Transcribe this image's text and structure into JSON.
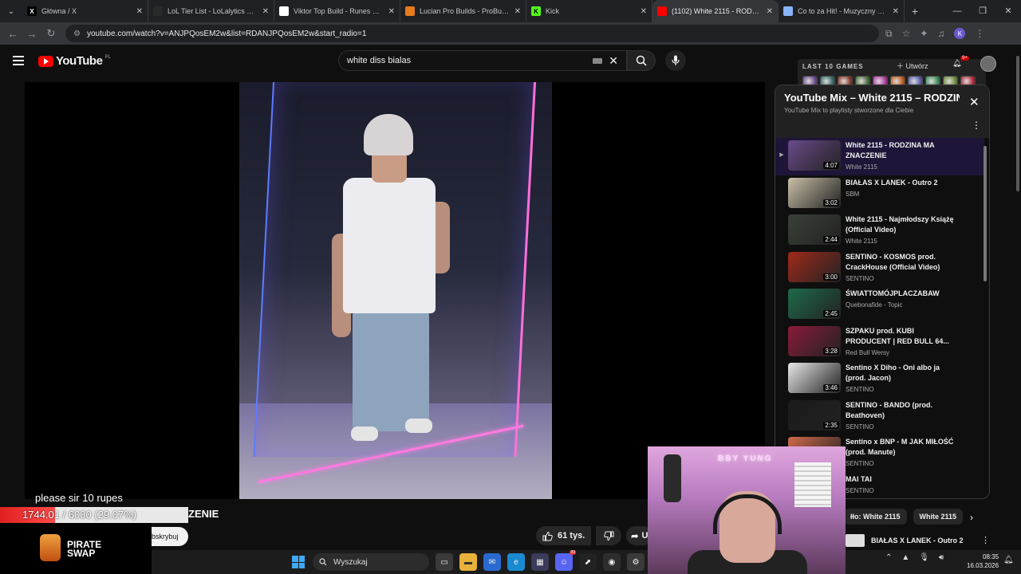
{
  "browser": {
    "tabs": [
      {
        "title": "Główna / X",
        "icon": "x-icon",
        "fav_color": "#000000",
        "fav_text": "X",
        "active": false
      },
      {
        "title": "LoL Tier List - LoLalytics LoL Tie",
        "icon": "lolalytics-icon",
        "fav_color": "#2a2a2a",
        "fav_text": "",
        "active": false
      },
      {
        "title": "Viktor Top Build - Runes & Item",
        "icon": "document-icon",
        "fav_color": "#ffffff",
        "fav_text": "",
        "active": false
      },
      {
        "title": "Lucian Pro Builds - ProBuilds.ne",
        "icon": "probuilds-icon",
        "fav_color": "#e87a1e",
        "fav_text": "",
        "active": false
      },
      {
        "title": "Kick",
        "icon": "kick-icon",
        "fav_color": "#53fc18",
        "fav_text": "K",
        "active": false
      },
      {
        "title": "(1102) White 2115 - RODZIN",
        "icon": "youtube-icon",
        "fav_color": "#ff0000",
        "fav_text": "",
        "active": true
      },
      {
        "title": "Co to za Hit! - Muzyczny Quiz I",
        "icon": "globe-icon",
        "fav_color": "#8ab4f8",
        "fav_text": "",
        "active": false
      }
    ],
    "url": "youtube.com/watch?v=ANJPQosEM2w&list=RDANJPQosEM2w&start_radio=1",
    "profile_initial": "K"
  },
  "header": {
    "logo_text": "YouTube",
    "country_code": "PL",
    "search_value": "white diss bialas"
  },
  "overlay_games": {
    "label": "LAST 10 GAMES",
    "create_label": "Utwórz",
    "notif_count": "9+",
    "champ_colors": [
      "#6b4a8a",
      "#3a6a6a",
      "#8a3a2a",
      "#4a6a3a",
      "#b03aa0",
      "#c05a1a",
      "#5a5aaa",
      "#3a8a5a",
      "#6a8a3a",
      "#b02a3a"
    ]
  },
  "video": {
    "donation_text": "please sir 10 rupes",
    "goal_text": "1744.01 / 6000 (29.07%)",
    "goal_fraction": 0.2907,
    "title_fragment": "ZENIE",
    "subscribe_fragment": "bskrybuj",
    "likes": "61 tys.",
    "share_fragment": "U",
    "sponsor_line1": "PIRATE",
    "sponsor_line2": "SWAP"
  },
  "playlist": {
    "title": "YouTube Mix – White 2115 – RODZINA",
    "subtitle": "YouTube Mix to playlisty stworzone dla Ciebie",
    "items": [
      {
        "title": "White 2115 - RODZINA MA ZNACZENIE",
        "channel": "White 2115",
        "duration": "4:07",
        "thumb": "#6a4a8a",
        "current": true
      },
      {
        "title": "BIAŁAS X LANEK - Outro 2",
        "channel": "SBM",
        "duration": "3:02",
        "thumb": "#c9c0a8",
        "current": false
      },
      {
        "title": "White 2115 - Najmłodszy Książę (Official Video)",
        "channel": "White 2115",
        "duration": "2:44",
        "thumb": "#3a4038",
        "current": false
      },
      {
        "title": "SENTINO - KOSMOS prod. CrackHouse (Official Video)",
        "channel": "SENTINO",
        "duration": "3:00",
        "thumb": "#a02a1a",
        "current": false
      },
      {
        "title": "ŚWIATTOMÓJPLACZABAW",
        "channel": "Quebonafide - Topic",
        "duration": "2:45",
        "thumb": "#1e6a4a",
        "current": false
      },
      {
        "title": "SZPAKU prod. KUBI PRODUCENT | RED BULL 64...",
        "channel": "Red Bull Wersy",
        "duration": "3:28",
        "thumb": "#8a1a3a",
        "current": false
      },
      {
        "title": "Sentino X Diho - Oni albo ja (prod. Jacon)",
        "channel": "SENTINO",
        "duration": "3:46",
        "thumb": "#e8e8e8",
        "current": false
      },
      {
        "title": "SENTINO - BANDO (prod. Beathoven)",
        "channel": "SENTINO",
        "duration": "2:35",
        "thumb": "#1a1a1a",
        "current": false
      },
      {
        "title": "Sentino x BNP - M JAK MIŁOŚĆ (prod. Manute)",
        "channel": "SENTINO",
        "duration": "",
        "thumb": "#d06a4a",
        "current": false
      },
      {
        "title": "MAI TAI",
        "channel": "SENTINO",
        "duration": "",
        "thumb": "#2a2a2a",
        "current": false
      }
    ]
  },
  "chips": {
    "items": [
      "łło: White 2115",
      "White 2115"
    ]
  },
  "recommendation": {
    "title": "BIAŁAS X LANEK - Outro 2"
  },
  "webcam": {
    "sign_text": "BBY YUNG"
  },
  "taskbar": {
    "search_placeholder": "Wyszukaj",
    "time": "08:35",
    "date": "16.03.2026",
    "chat_badge": "99"
  }
}
